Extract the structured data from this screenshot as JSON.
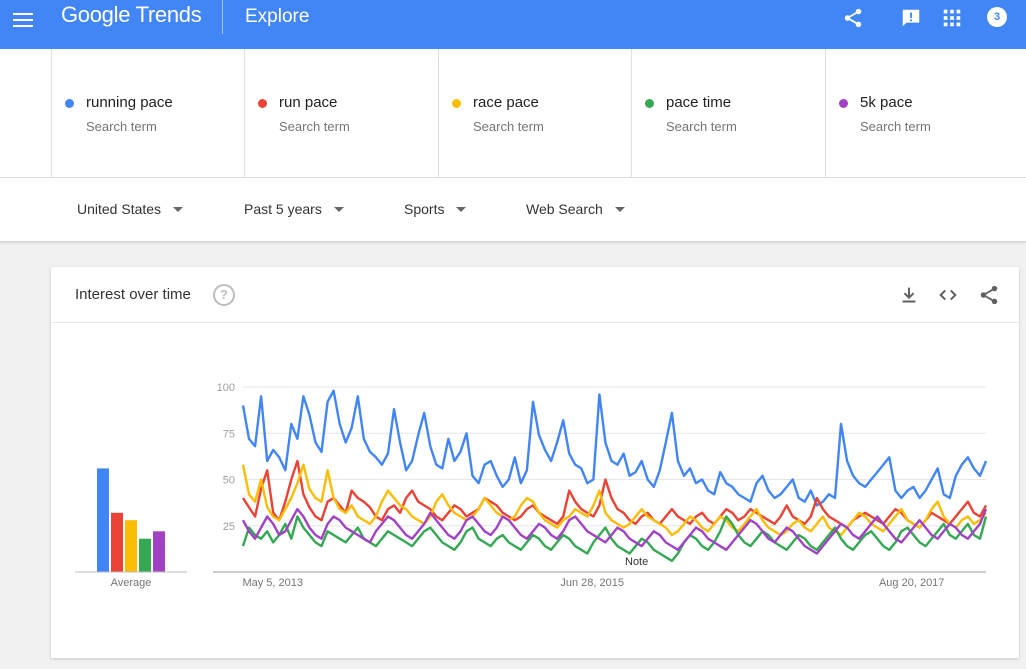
{
  "header": {
    "logo_google": "Google",
    "logo_trends": "Trends",
    "section": "Explore",
    "notification_count": "3"
  },
  "terms": [
    {
      "label": "running pace",
      "sub": "Search term",
      "color": "#4285f4"
    },
    {
      "label": "run pace",
      "sub": "Search term",
      "color": "#ea4335"
    },
    {
      "label": "race pace",
      "sub": "Search term",
      "color": "#fbbc04"
    },
    {
      "label": "pace time",
      "sub": "Search term",
      "color": "#34a853"
    },
    {
      "label": "5k pace",
      "sub": "Search term",
      "color": "#a142c4"
    }
  ],
  "filters": {
    "region": "United States",
    "time": "Past 5 years",
    "category": "Sports",
    "type": "Web Search"
  },
  "card": {
    "title": "Interest over time",
    "average_label": "Average",
    "note_label": "Note"
  },
  "chart_data": {
    "type": "line",
    "title": "Interest over time",
    "ylim": [
      0,
      100
    ],
    "yticks": [
      25,
      50,
      75,
      100
    ],
    "xtick_labels": [
      "May 5, 2013",
      "Jun 28, 2015",
      "Aug 20, 2017"
    ],
    "grid": true,
    "averages": {
      "categories": [
        "running pace",
        "run pace",
        "race pace",
        "pace time",
        "5k pace"
      ],
      "values": [
        56,
        32,
        28,
        18,
        22
      ]
    },
    "series": [
      {
        "name": "running pace",
        "color": "#4285f4",
        "values": [
          90,
          72,
          68,
          95,
          60,
          66,
          62,
          55,
          80,
          72,
          95,
          85,
          70,
          65,
          92,
          98,
          80,
          70,
          78,
          95,
          72,
          65,
          62,
          58,
          64,
          88,
          70,
          55,
          60,
          74,
          86,
          68,
          58,
          56,
          72,
          60,
          65,
          75,
          52,
          48,
          58,
          60,
          52,
          46,
          50,
          62,
          48,
          55,
          92,
          74,
          66,
          60,
          70,
          82,
          64,
          58,
          56,
          48,
          50,
          96,
          70,
          60,
          58,
          64,
          52,
          54,
          60,
          50,
          46,
          55,
          70,
          86,
          60,
          52,
          56,
          48,
          50,
          44,
          42,
          54,
          48,
          46,
          42,
          40,
          38,
          48,
          52,
          44,
          40,
          42,
          46,
          50,
          40,
          38,
          44,
          36,
          38,
          42,
          40,
          80,
          60,
          52,
          48,
          46,
          50,
          54,
          58,
          62,
          44,
          40,
          44,
          46,
          40,
          44,
          50,
          56,
          42,
          40,
          52,
          58,
          62,
          56,
          52,
          60
        ]
      },
      {
        "name": "run pace",
        "color": "#ea4335",
        "values": [
          40,
          35,
          30,
          45,
          55,
          32,
          28,
          38,
          50,
          60,
          42,
          35,
          30,
          28,
          38,
          40,
          36,
          32,
          44,
          40,
          38,
          35,
          30,
          28,
          34,
          36,
          32,
          40,
          44,
          38,
          36,
          34,
          30,
          28,
          32,
          36,
          34,
          30,
          32,
          34,
          40,
          38,
          36,
          32,
          30,
          28,
          30,
          34,
          36,
          32,
          30,
          28,
          26,
          30,
          44,
          38,
          34,
          32,
          30,
          36,
          50,
          40,
          34,
          32,
          28,
          26,
          30,
          32,
          28,
          26,
          30,
          34,
          30,
          28,
          26,
          30,
          32,
          28,
          26,
          30,
          34,
          32,
          28,
          30,
          34,
          32,
          30,
          28,
          26,
          30,
          36,
          30,
          28,
          26,
          30,
          40,
          34,
          30,
          28,
          26,
          24,
          28,
          30,
          32,
          30,
          28,
          26,
          30,
          34,
          32,
          28,
          26,
          24,
          28,
          32,
          30,
          28,
          26,
          30,
          34,
          38,
          32,
          30,
          36
        ]
      },
      {
        "name": "race pace",
        "color": "#fbbc04",
        "values": [
          58,
          42,
          38,
          50,
          35,
          30,
          28,
          34,
          40,
          48,
          58,
          45,
          40,
          38,
          55,
          40,
          34,
          32,
          36,
          30,
          28,
          26,
          30,
          38,
          44,
          40,
          36,
          34,
          30,
          28,
          26,
          30,
          38,
          42,
          36,
          32,
          30,
          28,
          30,
          34,
          40,
          36,
          32,
          30,
          28,
          30,
          36,
          40,
          38,
          32,
          28,
          26,
          24,
          28,
          30,
          34,
          32,
          30,
          36,
          44,
          32,
          28,
          26,
          24,
          26,
          30,
          34,
          30,
          28,
          26,
          24,
          20,
          22,
          26,
          30,
          28,
          24,
          22,
          26,
          30,
          28,
          24,
          22,
          26,
          30,
          34,
          28,
          24,
          22,
          20,
          22,
          26,
          28,
          24,
          22,
          26,
          30,
          24,
          22,
          20,
          24,
          28,
          32,
          30,
          26,
          24,
          22,
          26,
          30,
          34,
          28,
          26,
          24,
          28,
          34,
          38,
          30,
          26,
          24,
          28,
          30,
          26,
          28,
          32
        ]
      },
      {
        "name": "pace time",
        "color": "#34a853",
        "values": [
          14,
          24,
          20,
          18,
          22,
          16,
          20,
          26,
          18,
          30,
          24,
          20,
          16,
          14,
          22,
          20,
          18,
          16,
          20,
          24,
          18,
          16,
          14,
          18,
          22,
          20,
          18,
          16,
          14,
          18,
          22,
          24,
          20,
          16,
          14,
          12,
          16,
          22,
          24,
          18,
          16,
          14,
          18,
          20,
          16,
          14,
          12,
          16,
          20,
          18,
          14,
          12,
          16,
          20,
          18,
          14,
          12,
          10,
          16,
          20,
          24,
          18,
          14,
          12,
          10,
          14,
          18,
          16,
          12,
          10,
          8,
          6,
          10,
          16,
          20,
          18,
          14,
          12,
          16,
          22,
          30,
          26,
          20,
          16,
          14,
          18,
          22,
          20,
          16,
          14,
          12,
          16,
          20,
          18,
          14,
          12,
          16,
          20,
          24,
          18,
          14,
          12,
          16,
          20,
          22,
          18,
          14,
          12,
          16,
          22,
          24,
          20,
          16,
          14,
          18,
          22,
          26,
          20,
          18,
          22,
          26,
          20,
          18,
          30
        ]
      },
      {
        "name": "5k pace",
        "color": "#a142c4",
        "values": [
          28,
          22,
          18,
          24,
          30,
          26,
          20,
          22,
          28,
          34,
          30,
          24,
          20,
          18,
          26,
          30,
          28,
          24,
          22,
          20,
          18,
          16,
          22,
          26,
          30,
          28,
          24,
          20,
          18,
          22,
          26,
          32,
          28,
          24,
          20,
          18,
          22,
          28,
          30,
          26,
          22,
          20,
          24,
          30,
          28,
          24,
          20,
          18,
          22,
          26,
          24,
          20,
          18,
          22,
          28,
          30,
          26,
          22,
          20,
          18,
          16,
          20,
          24,
          22,
          18,
          16,
          14,
          18,
          22,
          20,
          16,
          14,
          12,
          16,
          20,
          24,
          22,
          18,
          16,
          14,
          12,
          16,
          20,
          24,
          28,
          26,
          22,
          18,
          16,
          20,
          24,
          22,
          18,
          14,
          12,
          10,
          14,
          18,
          22,
          26,
          24,
          20,
          18,
          22,
          26,
          30,
          26,
          22,
          18,
          16,
          20,
          24,
          28,
          24,
          20,
          18,
          22,
          26,
          24,
          20,
          18,
          22,
          26,
          34
        ]
      }
    ]
  }
}
